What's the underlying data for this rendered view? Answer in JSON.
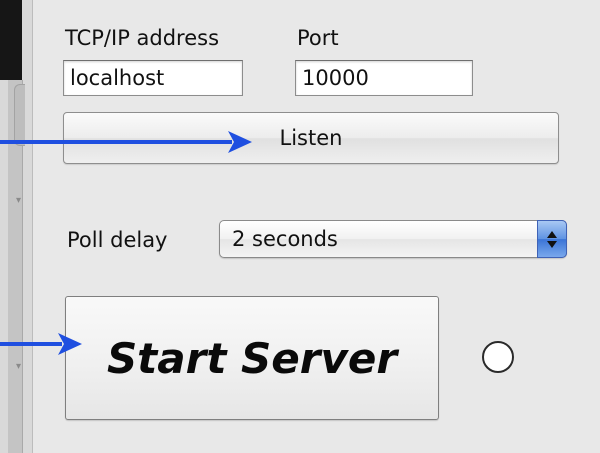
{
  "connection": {
    "address_label": "TCP/IP address",
    "address_value": "localhost",
    "port_label": "Port",
    "port_value": "10000"
  },
  "listen_button": {
    "label": "Listen"
  },
  "poll": {
    "label": "Poll delay",
    "selected": "2 seconds"
  },
  "start_button": {
    "label": "Start Server"
  },
  "colors": {
    "panel_background": "#e8e8e8",
    "callout_arrow": "#1f4fe0",
    "select_accent": "#4a80dc"
  },
  "icons": {
    "select_stepper": "up-down-arrows-icon",
    "status": "empty-circle-icon",
    "callouts": "right-arrow-icon"
  }
}
